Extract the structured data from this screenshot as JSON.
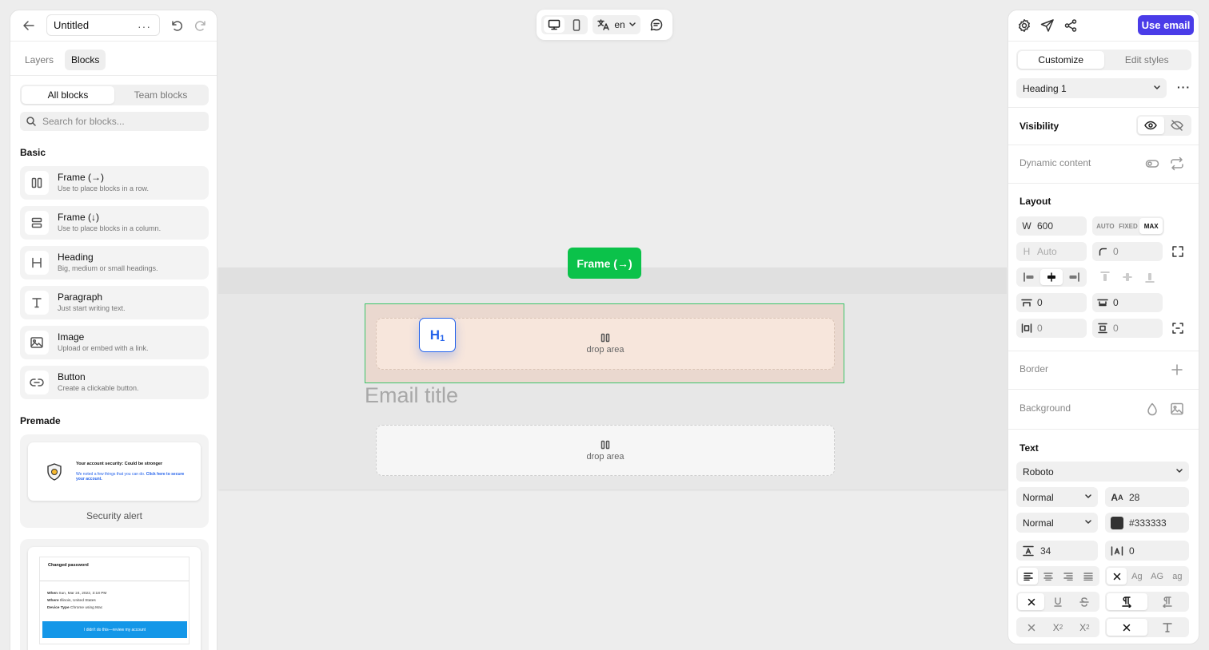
{
  "header": {
    "doc_title": "Untitled",
    "more": "···"
  },
  "left_tabs": [
    "Layers",
    "Blocks"
  ],
  "blocks_seg": [
    "All blocks",
    "Team blocks"
  ],
  "search": {
    "placeholder": "Search for blocks..."
  },
  "basic": {
    "title": "Basic",
    "items": [
      {
        "title": "Frame (→)",
        "desc": "Use to place blocks in a row.",
        "icon": "frame-row-icon"
      },
      {
        "title": "Frame (↓)",
        "desc": "Use to place blocks in a column.",
        "icon": "frame-column-icon"
      },
      {
        "title": "Heading",
        "desc": "Big, medium or small headings.",
        "icon": "heading-icon"
      },
      {
        "title": "Paragraph",
        "desc": "Just start writing text.",
        "icon": "paragraph-icon"
      },
      {
        "title": "Image",
        "desc": "Upload or embed with a link.",
        "icon": "image-icon"
      },
      {
        "title": "Button",
        "desc": "Create a clickable button.",
        "icon": "link-icon"
      }
    ]
  },
  "premade": {
    "title": "Premade",
    "security": {
      "label": "Security alert",
      "heading": "Your account security: Could be stronger",
      "body": "We noted a few things that you can do.",
      "link": "Click here to secure your account."
    },
    "password": {
      "heading": "Changed password",
      "when_label": "When",
      "when_value": "Sun, Mar 24, 2022, 3:18 PM",
      "where_label": "Where",
      "where_value": "Illinois, United States",
      "device_label": "Device Type",
      "device_value": "Chrome using Mac",
      "cta": "I didn't do this—review my account"
    }
  },
  "toolbar": {
    "lang": "en"
  },
  "canvas": {
    "frame_pill": "Frame (→)",
    "drop_area": "drop area",
    "drop_area_2": "drop area",
    "email_title": "Email title",
    "h1_badge": "H",
    "h1_sub": "1"
  },
  "right": {
    "use_email": "Use email",
    "tabs": [
      "Customize",
      "Edit styles"
    ],
    "element": "Heading 1",
    "visibility": "Visibility",
    "dynamic": "Dynamic content",
    "layout": "Layout",
    "w_label": "W",
    "w_value": "600",
    "size_modes": [
      "AUTO",
      "FIXED",
      "MAX"
    ],
    "h_label": "H",
    "h_value": "Auto",
    "radius": "0",
    "pad_top": "0",
    "pad_bottom": "0",
    "pad_x": "0",
    "pad_y": "0",
    "border": "Border",
    "background": "Background",
    "text": "Text",
    "font": "Roboto",
    "weight": "Normal",
    "style": "Normal",
    "size": "28",
    "color": "#333333",
    "line_height": "34",
    "letter_spacing": "0",
    "case_opts": [
      "Ag",
      "AG",
      "ag"
    ]
  },
  "colors": {
    "accent": "#4a3ce8",
    "frame_green": "#0bc24a",
    "selection_blue": "#2563eb"
  }
}
